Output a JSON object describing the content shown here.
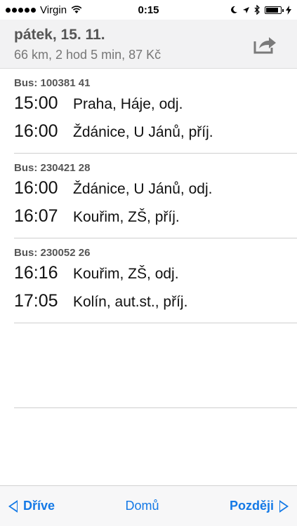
{
  "status": {
    "carrier": "Virgin",
    "time": "0:15"
  },
  "header": {
    "title": "pátek, 15. 11.",
    "subtitle": "66 km, 2 hod 5 min, 87 Kč"
  },
  "segments": [
    {
      "bus": "Bus: 100381 41",
      "stops": [
        {
          "time": "15:00",
          "place": "Praha, Háje, odj."
        },
        {
          "time": "16:00",
          "place": "Ždánice, U Jánů, příj."
        }
      ]
    },
    {
      "bus": "Bus: 230421 28",
      "stops": [
        {
          "time": "16:00",
          "place": "Ždánice, U Jánů, odj."
        },
        {
          "time": "16:07",
          "place": "Kouřim, ZŠ, příj."
        }
      ]
    },
    {
      "bus": "Bus: 230052 26",
      "stops": [
        {
          "time": "16:16",
          "place": "Kouřim, ZŠ, odj."
        },
        {
          "time": "17:05",
          "place": "Kolín, aut.st., příj."
        }
      ]
    }
  ],
  "toolbar": {
    "earlier": "Dříve",
    "home": "Domů",
    "later": "Později"
  },
  "colors": {
    "accent": "#1479e6",
    "header_bg": "#f2f2f3"
  }
}
